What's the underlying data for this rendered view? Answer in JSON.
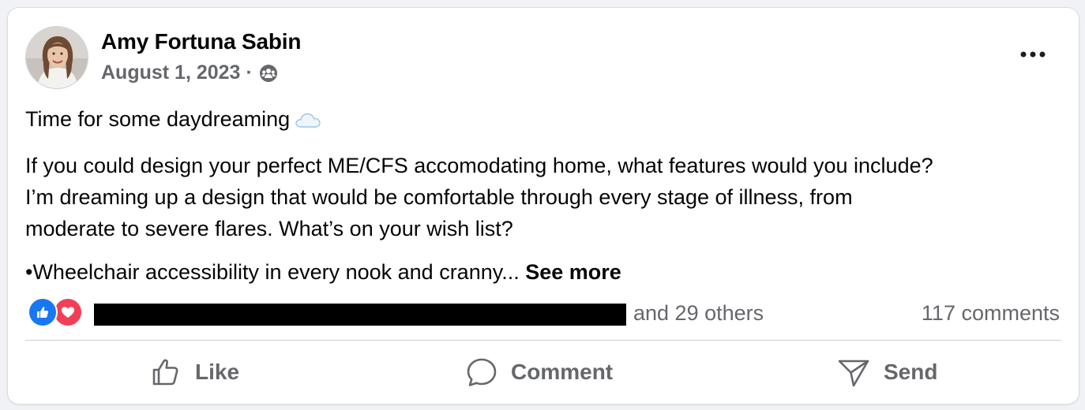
{
  "post": {
    "author": "Amy Fortuna Sabin",
    "date": "August 1, 2023",
    "separator": "·",
    "audience_icon": "group-audience-icon",
    "more_icon": "more-horizontal-icon",
    "paragraph1": "Time for some daydreaming",
    "paragraph1_emoji": "cloud-emoji",
    "paragraph2_line1": "If you could design your perfect ME/CFS accomodating home, what features would you include?",
    "paragraph2_line2": "I’m dreaming up a design that would be comfortable through every stage of illness, from",
    "paragraph2_line3": "moderate to severe flares. What’s on your wish list?",
    "paragraph3": "•Wheelchair accessibility in every nook and cranny...",
    "see_more": "See more"
  },
  "engagement": {
    "reaction_icons": [
      "like-reaction-icon",
      "love-reaction-icon"
    ],
    "others_text": "and 29 others",
    "comments_text": "117 comments"
  },
  "actions": {
    "like": "Like",
    "comment": "Comment",
    "send": "Send"
  },
  "colors": {
    "like_blue": "#1877f2",
    "love_red": "#f33e58",
    "secondary_text": "#65676b",
    "primary_text": "#050505"
  }
}
